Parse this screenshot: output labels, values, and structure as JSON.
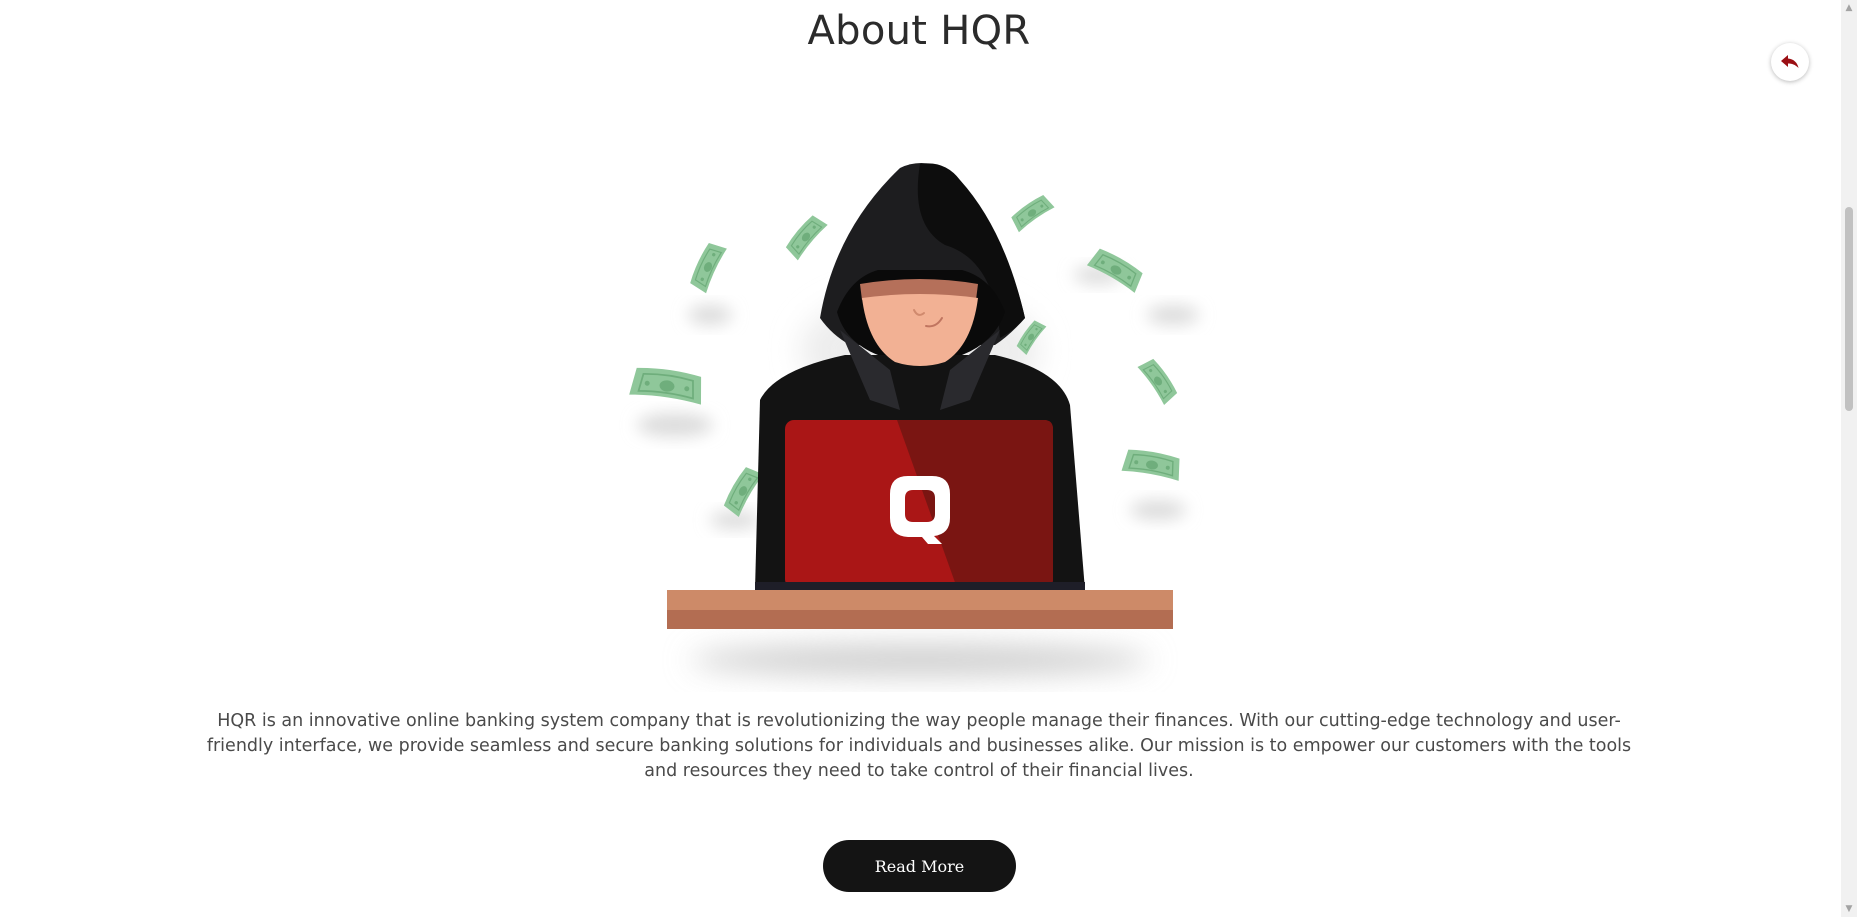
{
  "page": {
    "title": "About HQR",
    "description": "HQR is an innovative online banking system company that is revolutionizing the way people manage their finances. With our cutting-edge technology and user-friendly interface, we provide seamless and secure banking solutions for individuals and businesses alike. Our mission is to empower our customers with the tools and resources they need to take control of their financial lives.",
    "read_more_label": "Read More"
  },
  "back_button": {
    "icon": "reply-arrow-icon"
  },
  "illustration": {
    "subject": "hooded-hacker-with-laptop",
    "laptop_logo": "Q"
  },
  "colors": {
    "accent": "#9b0f14",
    "button_bg": "#141414",
    "button_text": "#ffffff",
    "title_text": "#2b2b2b",
    "body_text": "#4a4a4a"
  }
}
